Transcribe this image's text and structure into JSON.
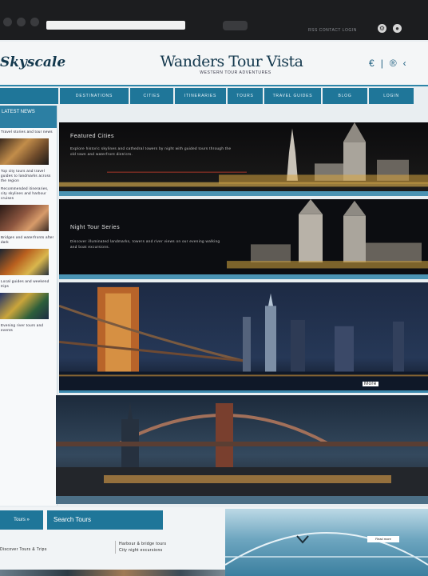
{
  "browser": {
    "toolbar_text": "RSS CONTACT LOGIN"
  },
  "header": {
    "logo": "Skyscale",
    "title": "Wanders Tour Vista",
    "tagline": "WESTERN TOUR ADVENTURES",
    "social_icons": [
      "facebook-icon",
      "twitter-icon",
      "chat-icon",
      "share-icon"
    ]
  },
  "nav": {
    "items": [
      "DESTINATIONS",
      "CITIES",
      "ITINERARIES",
      "TOURS",
      "TRAVEL GUIDES",
      "BLOG",
      "LOGIN"
    ]
  },
  "sidebar": {
    "heading": "LATEST NEWS",
    "blocks": [
      "Travel stories and tour news",
      "Top city tours and travel guides to landmarks across the region",
      "Recommended itineraries, city skylines and harbour cruises",
      "Bridges and waterfronts after dark",
      "Local guides and weekend trips",
      "Evening river tours and events"
    ]
  },
  "panels": [
    {
      "title": "Featured Cities",
      "text": "Explore historic skylines and cathedral towers by night with guided tours through the old town and waterfront districts."
    },
    {
      "title": "Night Tour Series",
      "text": "Discover illuminated landmarks, towers and river views on our evening walking and boat excursions."
    },
    {
      "caption": "More"
    },
    {
      "caption": ""
    }
  ],
  "bottom": {
    "tour_button": "Tours »",
    "search_button": "Search Tours",
    "left_text": "Discover Tours & Trips",
    "right_text": "Harbour & bridge tours\nCity night excursions",
    "image_label": "Read more"
  },
  "colors": {
    "accent": "#1f7699",
    "header_text": "#13384d",
    "panel_border": "#4a93b3"
  }
}
